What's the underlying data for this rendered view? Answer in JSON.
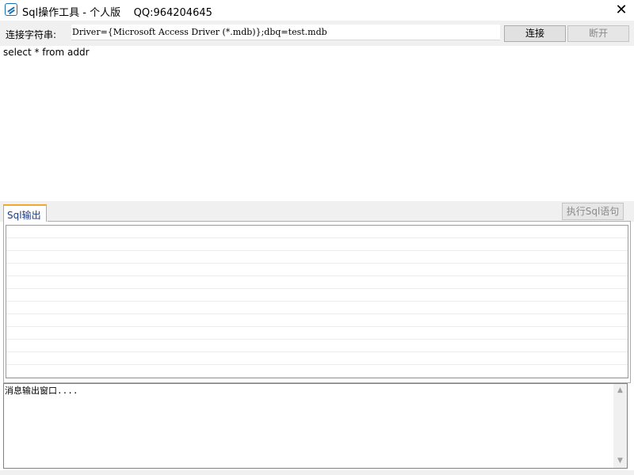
{
  "window": {
    "title": "Sql操作工具 - 个人版    QQ:964204645",
    "close_glyph": "✕",
    "icon": "app-icon"
  },
  "connection": {
    "label": "连接字符串:",
    "value": "Driver={Microsoft Access Driver (*.mdb)};dbq=test.mdb",
    "connect_label": "连接",
    "disconnect_label": "断开"
  },
  "editor": {
    "sql": "select * from addr"
  },
  "output": {
    "tab_label": "Sql输出",
    "execute_label": "执行Sql语句",
    "message": "消息输出窗口...."
  },
  "colors": {
    "tab_accent": "#f0a830",
    "window_bg": "#f0f0f0"
  }
}
